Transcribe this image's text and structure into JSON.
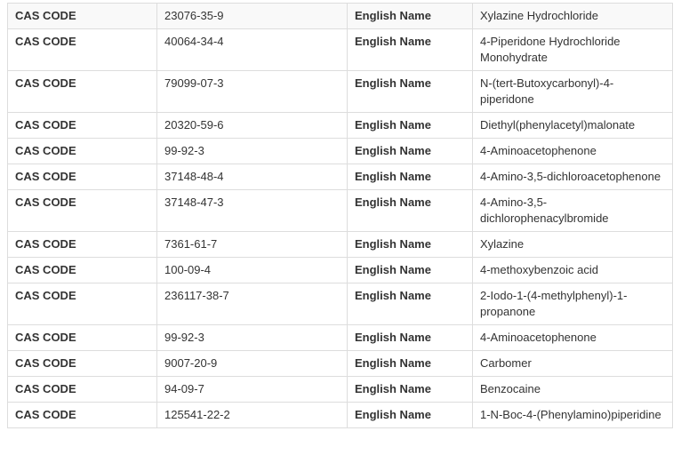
{
  "labels": {
    "cas": "CAS CODE",
    "name": "English Name"
  },
  "rows": [
    {
      "cas": "23076-35-9",
      "name": "Xylazine Hydrochloride"
    },
    {
      "cas": "40064-34-4",
      "name": "4-Piperidone Hydrochloride Monohydrate"
    },
    {
      "cas": "79099-07-3",
      "name": "N-(tert-Butoxycarbonyl)-4-piperidone"
    },
    {
      "cas": "20320-59-6",
      "name": "Diethyl(phenylacetyl)malonate"
    },
    {
      "cas": "99-92-3",
      "name": "4-Aminoacetophenone"
    },
    {
      "cas": "37148-48-4",
      "name": "4-Amino-3,5-dichloroacetophenone"
    },
    {
      "cas": "37148-47-3",
      "name": "4-Amino-3,5-dichlorophenacylbromide"
    },
    {
      "cas": "7361-61-7",
      "name": "Xylazine"
    },
    {
      "cas": "100-09-4",
      "name": "4-methoxybenzoic acid"
    },
    {
      "cas": "236117-38-7",
      "name": "2-Iodo-1-(4-methylphenyl)-1-propanone"
    },
    {
      "cas": "99-92-3",
      "name": "4-Aminoacetophenone"
    },
    {
      "cas": "9007-20-9",
      "name": "Carbomer"
    },
    {
      "cas": "94-09-7",
      "name": "Benzocaine"
    },
    {
      "cas": "125541-22-2",
      "name": "1-N-Boc-4-(Phenylamino)piperidine"
    }
  ]
}
